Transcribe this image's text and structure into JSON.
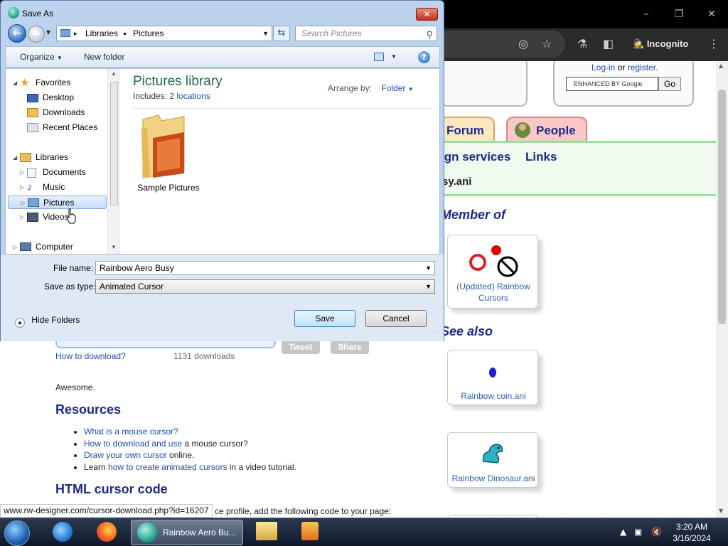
{
  "browser": {
    "profile_label": "Incognito",
    "minimize_glyph": "–",
    "maximize_glyph": "❐",
    "close_glyph": "✕"
  },
  "webpage": {
    "login_text": "Log-in",
    "login_or": "or",
    "register_text": "register.",
    "search_placeholder": "ENHANCED BY Google",
    "go_label": "Go",
    "tabs": [
      {
        "label": "Forum"
      },
      {
        "label": "People"
      }
    ],
    "nav_links": [
      "ign services",
      "Links"
    ],
    "filename_fragment": "sy.ani",
    "member_of_heading": "Member of",
    "member_card_label": "(Updated) Rainbow Cursors",
    "see_also_heading": "See also",
    "see_also_cards": [
      {
        "label": "Rainbow coin.ani"
      },
      {
        "label": "Rainbow Dinosaur.ani"
      }
    ],
    "how_to_download": "How to download?",
    "download_count": "1131 downloads",
    "tweet_label": "Tweet",
    "share_label": "Share",
    "comment": "Awesome.",
    "resources_heading": "Resources",
    "resources": {
      "r1": "What is a mouse cursor?",
      "r2_link": "How to download and use",
      "r2_rest": " a mouse cursor?",
      "r3_link": "Draw your own cursor",
      "r3_rest": " online.",
      "r4_pre": "Learn ",
      "r4_link": "how to create animated cursors",
      "r4_rest": " in a video tutorial."
    },
    "html_code_heading": "HTML cursor code",
    "code_hint": "ce profile, add the following code to your page:",
    "status_url": "www.rw-designer.com/cursor-download.php?id=16207"
  },
  "dialog": {
    "title": "Save As",
    "breadcrumbs": [
      "Libraries",
      "Pictures"
    ],
    "search_placeholder": "Search Pictures",
    "organize_label": "Organize",
    "new_folder_label": "New folder",
    "nav_tree": {
      "favorites": "Favorites",
      "desktop": "Desktop",
      "downloads": "Downloads",
      "recent_places": "Recent Places",
      "libraries": "Libraries",
      "documents": "Documents",
      "music": "Music",
      "pictures": "Pictures",
      "videos": "Videos",
      "computer": "Computer"
    },
    "library_title": "Pictures library",
    "includes_label": "Includes:",
    "includes_link": "2 locations",
    "arrange_by_label": "Arrange by:",
    "arrange_by_value": "Folder",
    "folder_item": "Sample Pictures",
    "file_name_label": "File name:",
    "file_name_value": "Rainbow Aero Busy",
    "save_type_label": "Save as type:",
    "save_type_value": "Animated Cursor",
    "hide_folders_label": "Hide Folders",
    "save_button": "Save",
    "cancel_button": "Cancel"
  },
  "taskbar": {
    "active_window_label": "Rainbow Aero Bu...",
    "time": "3:20 AM",
    "date": "3/16/2024"
  }
}
